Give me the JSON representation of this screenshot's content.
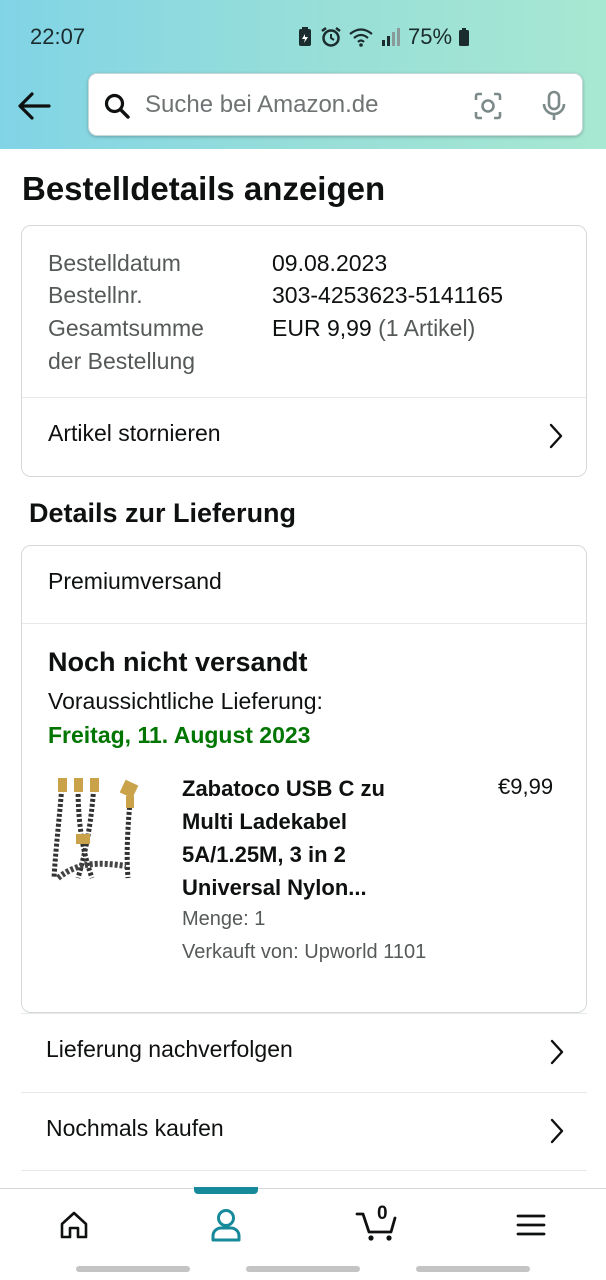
{
  "status_bar": {
    "time": "22:07",
    "battery": "75%"
  },
  "search": {
    "placeholder": "Suche bei Amazon.de"
  },
  "page_title": "Bestelldetails anzeigen",
  "order": {
    "date_label": "Bestelldatum",
    "date_value": "09.08.2023",
    "number_label": "Bestellnr.",
    "number_value": "303-4253623-5141165",
    "total_label_line1": "Gesamtsumme",
    "total_label_line2": "der Bestellung",
    "total_value": "EUR 9,99",
    "total_count": "(1 Artikel)",
    "cancel_label": "Artikel stornieren"
  },
  "delivery": {
    "section_title": "Details zur Lieferung",
    "shipping_type": "Premiumversand",
    "status": "Noch nicht versandt",
    "eta_label": "Voraussichtliche Lieferung:",
    "eta_date": "Freitag, 11. August 2023",
    "product": {
      "title": "Zabatoco USB C zu Multi Ladekabel 5A/1.25M, 3 in 2 Universal Nylon...",
      "price": "€9,99",
      "quantity": "Menge: 1",
      "seller": "Verkauft von: Upworld 1101"
    }
  },
  "actions": {
    "track": "Lieferung nachverfolgen",
    "buy_again": "Nochmals kaufen"
  },
  "bottom_nav": {
    "cart_count": "0",
    "items": [
      "home-icon",
      "account-icon",
      "cart-icon",
      "menu-icon"
    ],
    "active_color": "#168a9a"
  },
  "colors": {
    "eta_green": "#007600",
    "header_gradient_start": "#81d4e6",
    "header_gradient_end": "#a7e8d2"
  }
}
